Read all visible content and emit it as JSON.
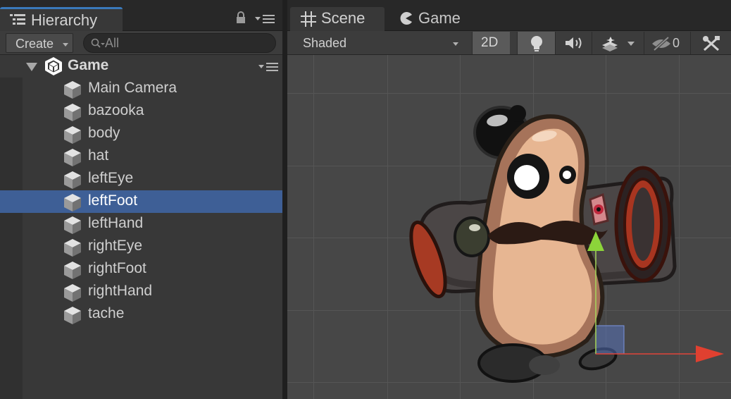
{
  "hierarchy": {
    "tab_label": "Hierarchy",
    "toolbar": {
      "create_label": "Create",
      "search_placeholder": "All"
    },
    "root": {
      "label": "Game"
    },
    "items": [
      {
        "label": "Main Camera",
        "selected": false
      },
      {
        "label": "bazooka",
        "selected": false
      },
      {
        "label": "body",
        "selected": false
      },
      {
        "label": "hat",
        "selected": false
      },
      {
        "label": "leftEye",
        "selected": false
      },
      {
        "label": "leftFoot",
        "selected": true
      },
      {
        "label": "leftHand",
        "selected": false
      },
      {
        "label": "rightEye",
        "selected": false
      },
      {
        "label": "rightFoot",
        "selected": false
      },
      {
        "label": "rightHand",
        "selected": false
      },
      {
        "label": "tache",
        "selected": false
      }
    ]
  },
  "scene": {
    "tabs": {
      "scene_label": "Scene",
      "game_label": "Game"
    },
    "toolbar": {
      "shading_mode": "Shaded",
      "mode_2d_label": "2D",
      "hidden_count": "0"
    }
  },
  "colors": {
    "selection": "#3e5f96",
    "accent_tab": "#3a79bb",
    "panel_bg": "#383838",
    "viewport_bg": "#474747"
  }
}
